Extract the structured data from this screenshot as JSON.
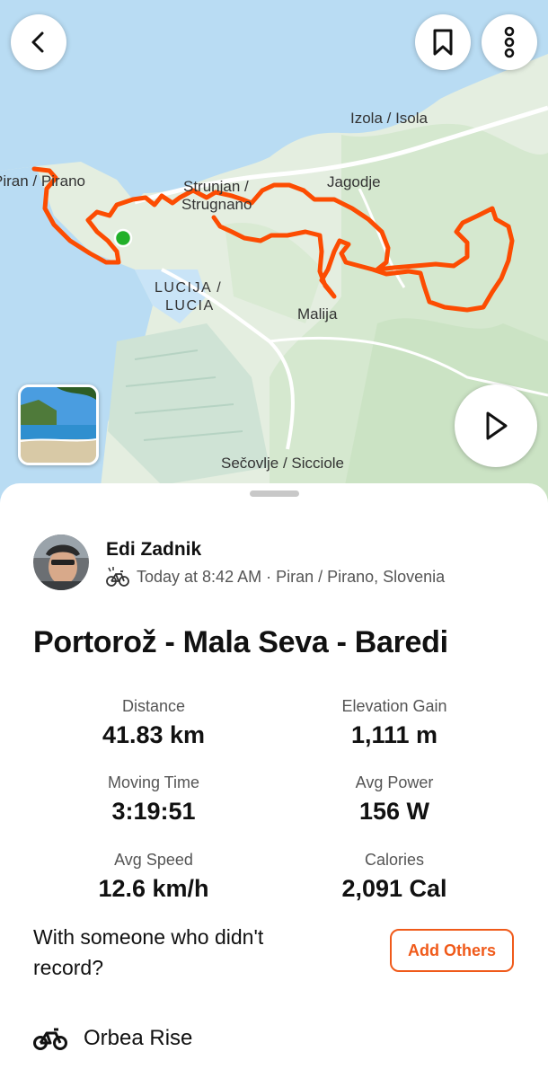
{
  "map": {
    "labels": {
      "izola": "Izola / Isola",
      "piran": "Piran / Pirano",
      "jagodje": "Jagodje",
      "strunjan_1": "Strunjan /",
      "strunjan_2": "Strugnano",
      "lucija_1": "LUCIJA /",
      "lucija_2": "LUCIA",
      "malija": "Malija",
      "secovlje": "Sečovlje / Sicciole"
    },
    "route_color": "#fc4c02",
    "start_color": "#22b02a"
  },
  "header": {
    "back_icon": "chevron-left-icon",
    "bookmark_icon": "bookmark-icon",
    "more_icon": "more-vertical-icon"
  },
  "activity": {
    "athlete_name": "Edi Zadnik",
    "meta": "Today at 8:42 AM · Piran / Pirano, Slovenia",
    "title": "Portorož - Mala Seva - Baredi",
    "stats": [
      {
        "label": "Distance",
        "value": "41.83 km"
      },
      {
        "label": "Elevation Gain",
        "value": "1,111 m"
      },
      {
        "label": "Moving Time",
        "value": "3:19:51"
      },
      {
        "label": "Avg Power",
        "value": "156 W"
      },
      {
        "label": "Avg Speed",
        "value": "12.6 km/h"
      },
      {
        "label": "Calories",
        "value": "2,091 Cal"
      }
    ],
    "with_text": "With someone who didn't record?",
    "add_others_label": "Add Others",
    "gear_name": "Orbea Rise",
    "accent": "#f05a1a"
  }
}
